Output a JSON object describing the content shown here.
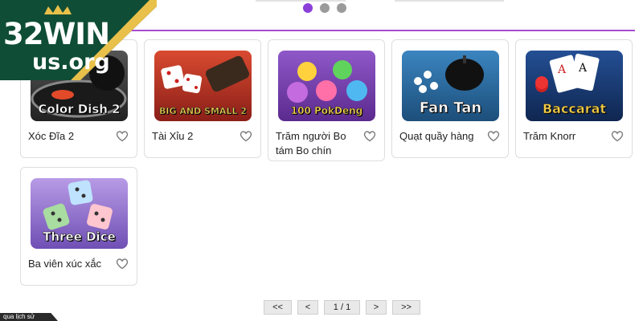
{
  "logo": {
    "brand": "32WIN",
    "domain": "us.org"
  },
  "carousel": {
    "pages": 3,
    "active": 0
  },
  "games": [
    {
      "title": "Xóc Đĩa 2",
      "thumb_text": "Color Dish 2",
      "thumb_bg": "#3b3b3b",
      "accent": "#e2572d"
    },
    {
      "title": "Tài Xỉu 2",
      "thumb_text": "BIG AND SMALL 2",
      "thumb_bg": "#c8362a",
      "accent": "#f2c24a"
    },
    {
      "title": "Trăm người Bo tám Bo chín",
      "thumb_text": "100 PokDeng",
      "thumb_bg": "#7a3fb8",
      "accent": "#f6d13a"
    },
    {
      "title": "Quạt quầy hàng",
      "thumb_text": "Fan Tan",
      "thumb_bg": "#2a6aa0",
      "accent": "#ffffff"
    },
    {
      "title": "Trăm Knorr",
      "thumb_text": "Baccarat",
      "thumb_bg": "#1d3f7a",
      "accent": "#f3c43a"
    },
    {
      "title": "Ba viên xúc xắc",
      "thumb_text": "Three Dice",
      "thumb_bg": "#9a7fd6",
      "accent": "#f3d23d"
    }
  ],
  "pagination": {
    "first": "<<",
    "prev": "<",
    "current": "1 / 1",
    "next": ">",
    "last": ">>"
  },
  "history_tab": "qua lịch sử",
  "colors": {
    "accent_purple": "#8b3fd9",
    "logo_green": "#0f4d36",
    "logo_gold": "#e8c04a"
  }
}
